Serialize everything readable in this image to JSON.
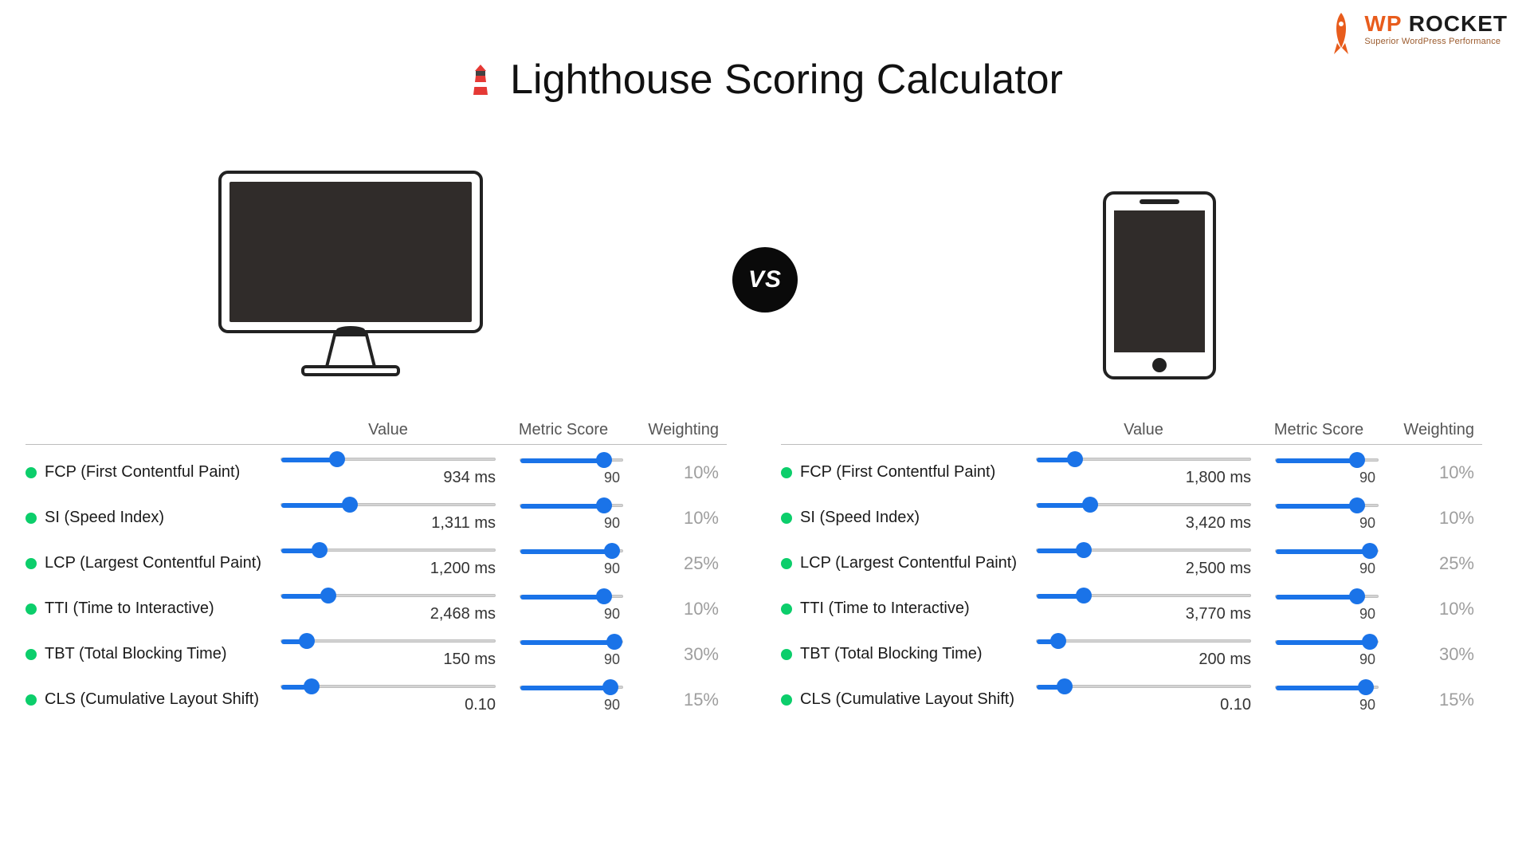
{
  "brand": {
    "prefix": "WP",
    "name": " ROCKET",
    "tagline": "Superior WordPress Performance"
  },
  "title": "Lighthouse Scoring Calculator",
  "vs_label": "VS",
  "columns": {
    "value": "Value",
    "score": "Metric Score",
    "weight": "Weighting"
  },
  "desktop": {
    "rows": [
      {
        "label": "FCP (First Contentful Paint)",
        "value_text": "934 ms",
        "value_fill": 26,
        "score": "90",
        "score_fill": 82,
        "weight": "10%"
      },
      {
        "label": "SI (Speed Index)",
        "value_text": "1,311 ms",
        "value_fill": 32,
        "score": "90",
        "score_fill": 82,
        "weight": "10%"
      },
      {
        "label": "LCP (Largest Contentful Paint)",
        "value_text": "1,200 ms",
        "value_fill": 18,
        "score": "90",
        "score_fill": 90,
        "weight": "25%"
      },
      {
        "label": "TTI (Time to Interactive)",
        "value_text": "2,468 ms",
        "value_fill": 22,
        "score": "90",
        "score_fill": 82,
        "weight": "10%"
      },
      {
        "label": "TBT (Total Blocking Time)",
        "value_text": "150 ms",
        "value_fill": 12,
        "score": "90",
        "score_fill": 92,
        "weight": "30%"
      },
      {
        "label": "CLS (Cumulative Layout Shift)",
        "value_text": "0.10",
        "value_fill": 14,
        "score": "90",
        "score_fill": 88,
        "weight": "15%"
      }
    ]
  },
  "mobile": {
    "rows": [
      {
        "label": "FCP (First Contentful Paint)",
        "value_text": "1,800 ms",
        "value_fill": 18,
        "score": "90",
        "score_fill": 80,
        "weight": "10%"
      },
      {
        "label": "SI (Speed Index)",
        "value_text": "3,420 ms",
        "value_fill": 25,
        "score": "90",
        "score_fill": 80,
        "weight": "10%"
      },
      {
        "label": "LCP (Largest Contentful Paint)",
        "value_text": "2,500 ms",
        "value_fill": 22,
        "score": "90",
        "score_fill": 92,
        "weight": "25%"
      },
      {
        "label": "TTI (Time to Interactive)",
        "value_text": "3,770 ms",
        "value_fill": 22,
        "score": "90",
        "score_fill": 80,
        "weight": "10%"
      },
      {
        "label": "TBT (Total Blocking Time)",
        "value_text": "200 ms",
        "value_fill": 10,
        "score": "90",
        "score_fill": 92,
        "weight": "30%"
      },
      {
        "label": "CLS (Cumulative Layout Shift)",
        "value_text": "0.10",
        "value_fill": 13,
        "score": "90",
        "score_fill": 88,
        "weight": "15%"
      }
    ]
  }
}
